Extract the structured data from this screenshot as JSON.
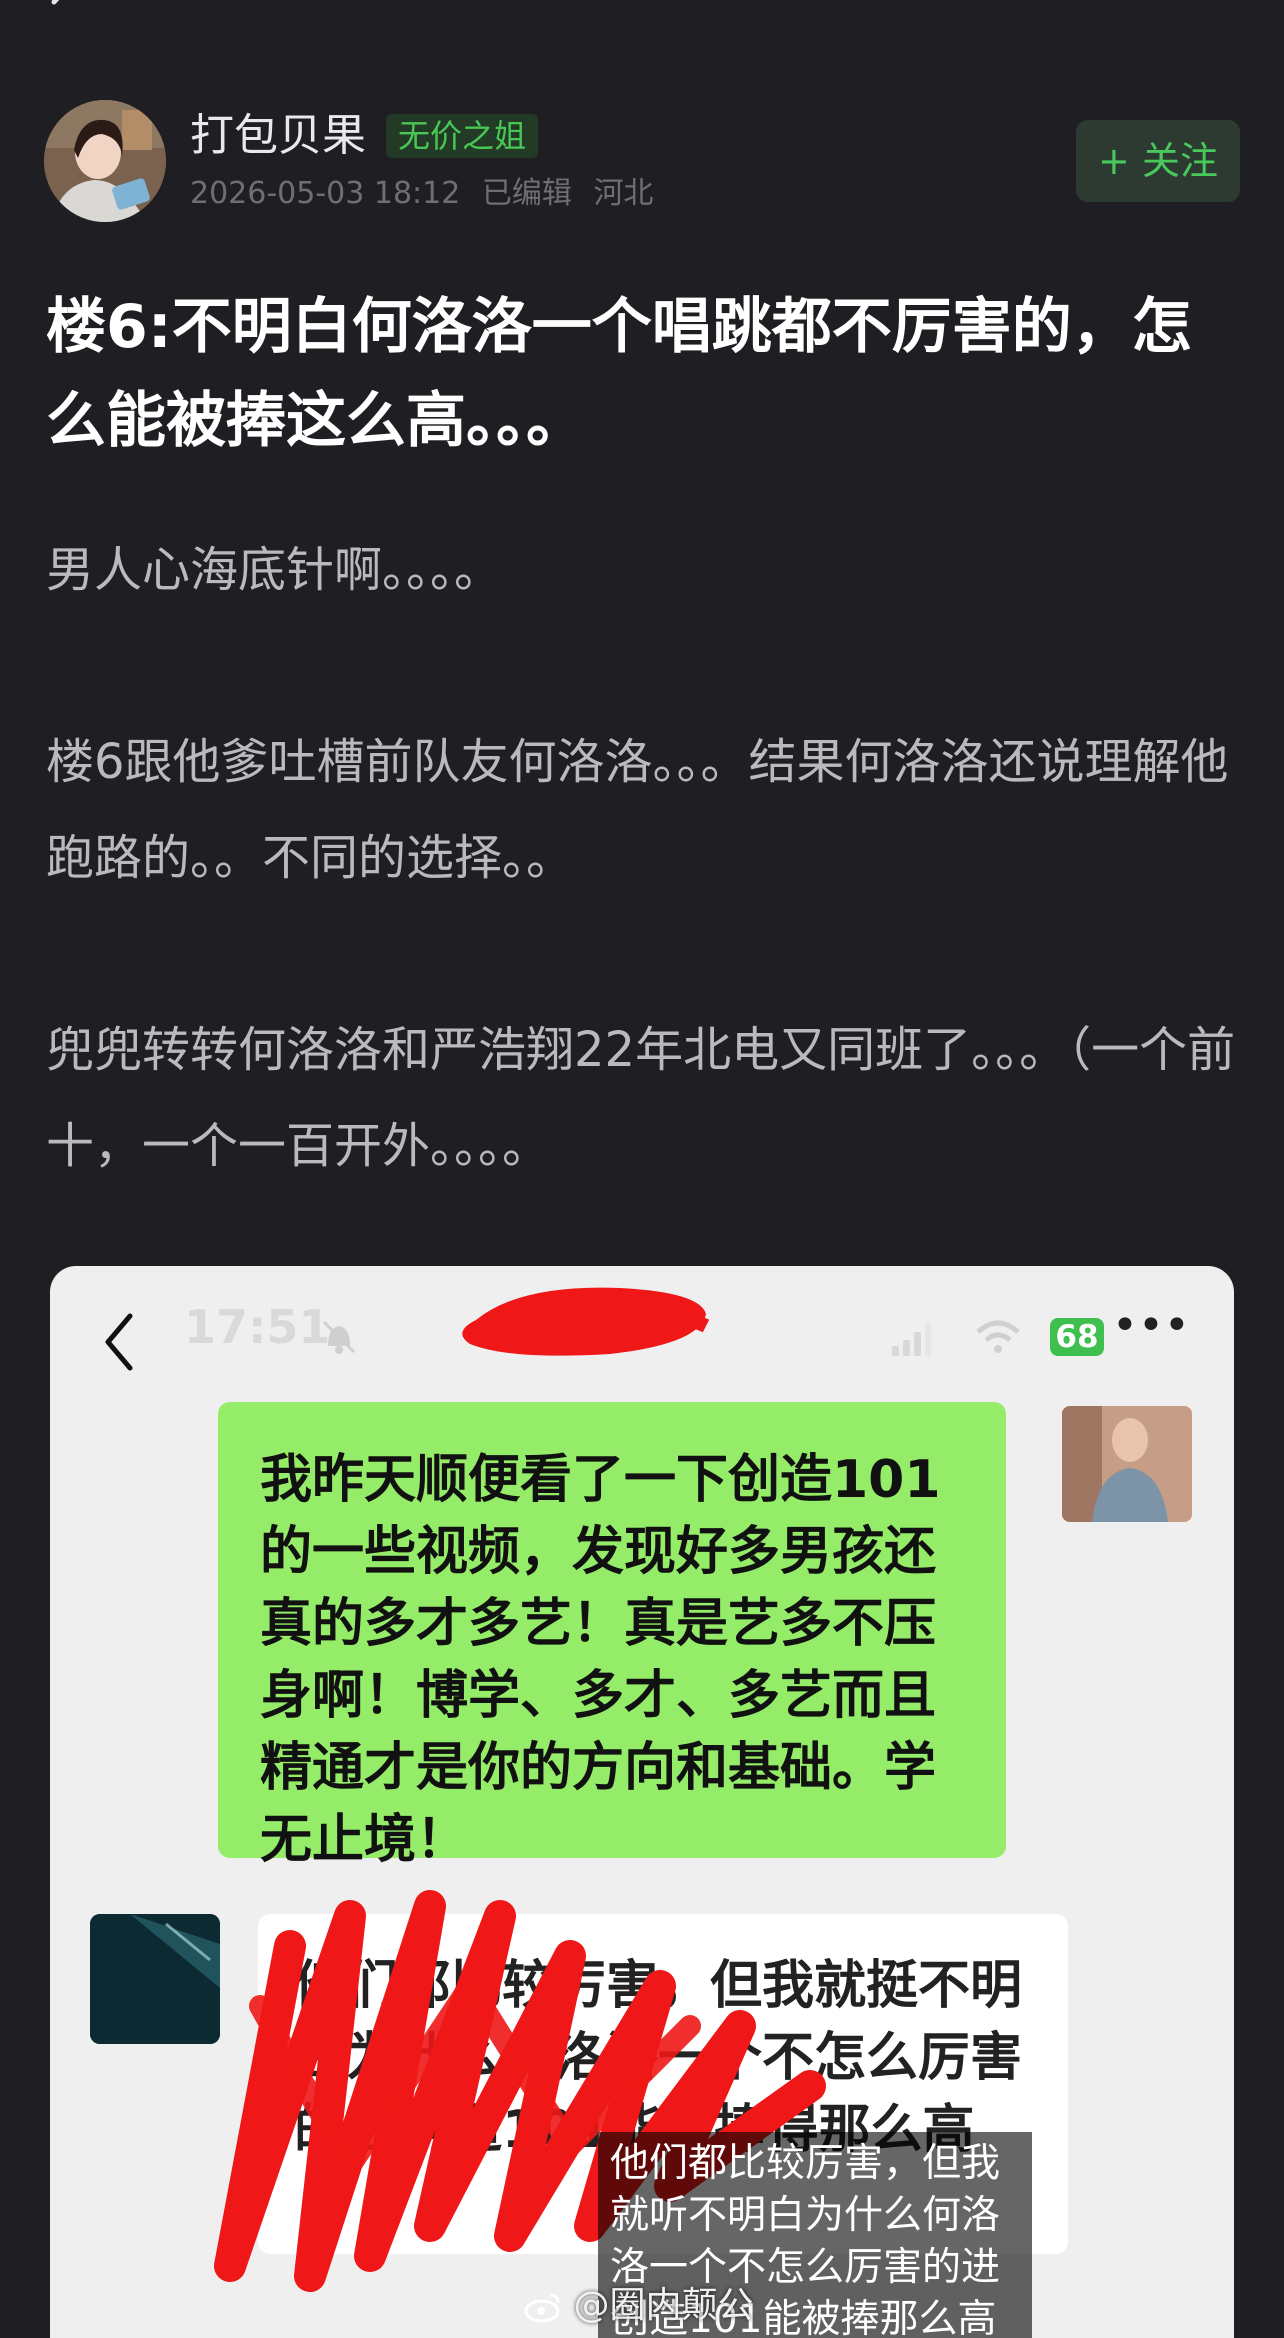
{
  "post": {
    "author": {
      "name": "打包贝果",
      "badge": "无价之姐",
      "date": "2026-05-03 18:12",
      "edited": "已编辑",
      "location": "河北"
    },
    "follow_label": "+ 关注",
    "title": "楼6:不明白何洛洛一个唱跳都不厉害的，怎么能被捧这么高。。。",
    "paragraphs": [
      "男人心海底针啊。。。。",
      "楼6跟他爹吐槽前队友何洛洛。。。结果何洛洛还说理解他跑路的。。不同的选择。。",
      "兜兜转转何洛洛和严浩翔22年北电又同班了。。。（一个前十，一个一百开外。。。。"
    ]
  },
  "screenshot": {
    "status_time": "17:51",
    "battery": "68",
    "green_message": "我昨天顺便看了一下创造101的一些视频，发现好多男孩还真的多才多艺！真是艺多不压身啊！博学、多才、多艺而且精通才是你的方向和基础。学无止境！",
    "white_message_visible": "他们都比较厉害，但我就挺不明白为什么何洛洛一个不怎么厉害的进创造101能被捧得那么高",
    "subtitle": "他们都比较厉害，但我就听不明白为什么何洛洛一个不怎么厉害的进创造101能被捧那么高",
    "watermark": "@圈内颠公"
  },
  "colors": {
    "background": "#1f1f23",
    "accent_green": "#49c95b",
    "bubble_green": "#95ec69",
    "redaction_red": "#ef1717"
  }
}
